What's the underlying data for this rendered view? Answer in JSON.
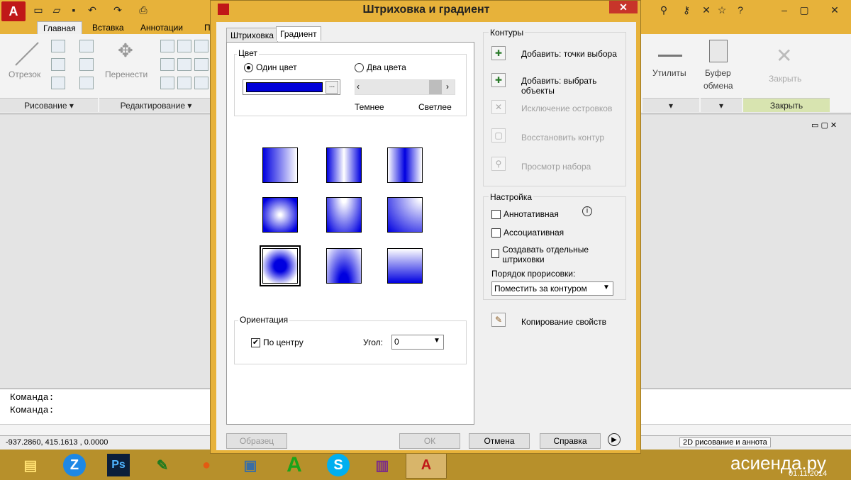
{
  "ribbon": {
    "tabs": [
      {
        "label": "Главная",
        "active": true
      },
      {
        "label": "Вставка"
      },
      {
        "label": "Аннотации"
      },
      {
        "label": "П"
      }
    ],
    "tools": {
      "line_label": "Отрезок",
      "move_label": "Перенести",
      "utilities_label": "Утилиты",
      "clipboard_label1": "Буфер",
      "clipboard_label2": "обмена",
      "close_label": "Закрыть"
    },
    "panels": {
      "draw": "Рисование ▾",
      "edit": "Редактирование ▾",
      "close": "Закрыть"
    }
  },
  "dialog": {
    "title": "Штриховка и градиент",
    "tabs": [
      {
        "label": "Штриховка"
      },
      {
        "label": "Градиент",
        "active": true
      }
    ],
    "color": {
      "legend": "Цвет",
      "one_color": "Один цвет",
      "two_color": "Два цвета",
      "browse": "...",
      "darker": "Темнее",
      "lighter": "Светлее",
      "swatch": "#0000d8"
    },
    "orientation": {
      "legend": "Ориентация",
      "centered": "По центру",
      "angle_label": "Угол:",
      "angle_value": "0"
    },
    "contours": {
      "legend": "Контуры",
      "add_pick": "Добавить: точки выбора",
      "add_select": "Добавить: выбрать объекты",
      "remove_islands": "Исключение островков",
      "recreate": "Восстановить контур",
      "view_selection": "Просмотр набора"
    },
    "options": {
      "legend": "Настройка",
      "annotative": "Аннотативная",
      "associative": "Ассоциативная",
      "separate": "Создавать отдельные штриховки",
      "draw_order_label": "Порядок прорисовки:",
      "draw_order_value": "Поместить за контуром"
    },
    "inherit": "Копирование свойств",
    "buttons": {
      "preview": "Образец",
      "ok": "ОК",
      "cancel": "Отмена",
      "help": "Справка"
    }
  },
  "command": {
    "line1": "Команда:",
    "line2": "Команда:"
  },
  "status": {
    "coords": "-937.2860, 415.1613 , 0.0000",
    "workspace": "2D рисование и аннота"
  },
  "taskbar": {
    "watermark": "асиенда.ру",
    "date": "01.11.2014"
  },
  "colors": {
    "accent": "#e7b23a",
    "gradient": "#0000e0"
  }
}
